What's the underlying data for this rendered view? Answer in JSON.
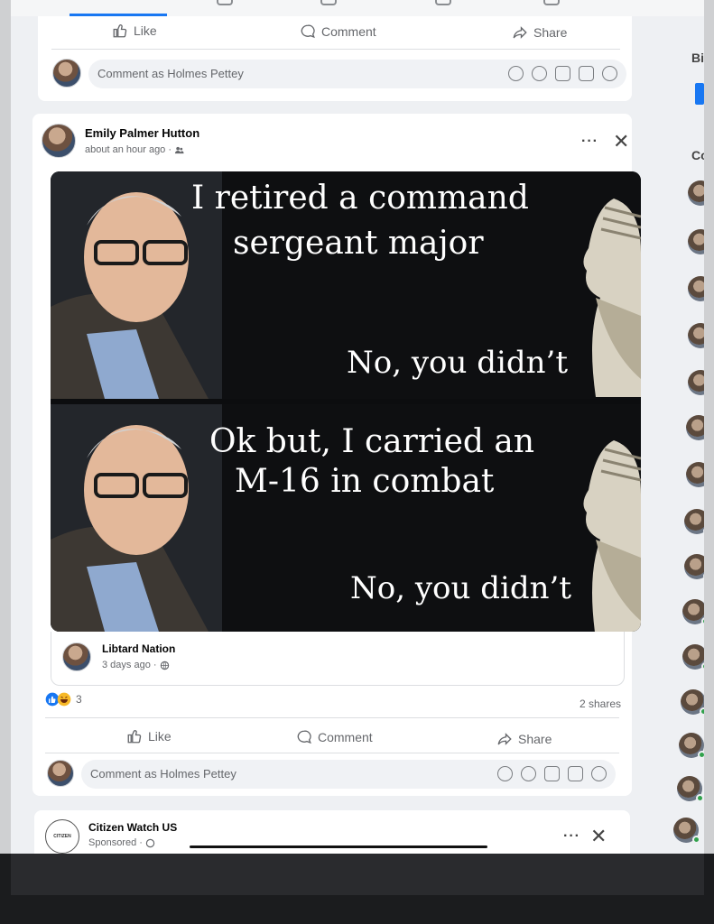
{
  "previous_post": {
    "like_label": "Like",
    "comment_label": "Comment",
    "share_label": "Share",
    "comment_placeholder": "Comment as Holmes Pettey"
  },
  "post": {
    "author": "Emily Palmer Hutton",
    "timestamp": "about an hour ago ·",
    "meme": {
      "top_line1": "I retired a command",
      "top_line2": "sergeant major",
      "top_reply": "No, you didn’t",
      "bottom_line1": "Ok but, I carried an",
      "bottom_line2": "M-16 in combat",
      "bottom_reply": "No, you didn’t"
    },
    "shared_from": {
      "name": "Libtard Nation",
      "timestamp": "3 days ago ·"
    },
    "reaction_count": "3",
    "shares": "2 shares",
    "like_label": "Like",
    "comment_label": "Comment",
    "share_label": "Share",
    "comment_placeholder": "Comment as Holmes Pettey"
  },
  "sponsored_post": {
    "name": "Citizen Watch US",
    "label": "Sponsored ·",
    "logo_text": "CITIZEN"
  },
  "sidebar": {
    "section_b": "Bi",
    "section_c": "Co"
  },
  "colors": {
    "accent": "#1877f2",
    "online": "#31a24c"
  }
}
